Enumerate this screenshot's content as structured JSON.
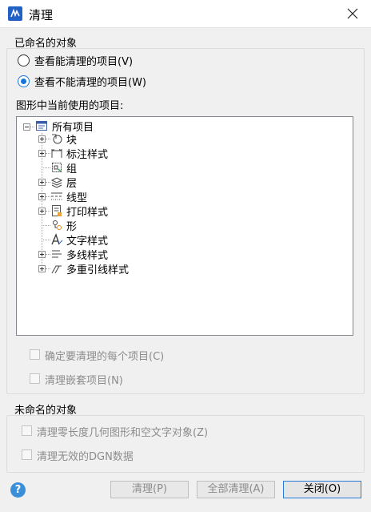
{
  "window": {
    "title": "清理",
    "icon": "app-logo-icon",
    "close_icon": "close-icon"
  },
  "named_objects": {
    "group_title": "已命名的对象",
    "radio_purgeable": "查看能清理的项目(V)",
    "radio_not_purgeable": "查看不能清理的项目(W)",
    "selected_radio": "radio_not_purgeable",
    "tree_label": "图形中当前使用的项目:",
    "tree": {
      "root": "所有项目",
      "items": [
        {
          "label": "块",
          "icon": "block-icon",
          "expandable": true
        },
        {
          "label": "标注样式",
          "icon": "dimension-style-icon",
          "expandable": true
        },
        {
          "label": "组",
          "icon": "group-icon",
          "expandable": false
        },
        {
          "label": "层",
          "icon": "layer-icon",
          "expandable": true
        },
        {
          "label": "线型",
          "icon": "linetype-icon",
          "expandable": true
        },
        {
          "label": "打印样式",
          "icon": "plot-style-icon",
          "expandable": true
        },
        {
          "label": "形",
          "icon": "shape-icon",
          "expandable": false
        },
        {
          "label": "文字样式",
          "icon": "text-style-icon",
          "expandable": false
        },
        {
          "label": "多线样式",
          "icon": "multiline-style-icon",
          "expandable": true
        },
        {
          "label": "多重引线样式",
          "icon": "multileader-style-icon",
          "expandable": true
        }
      ]
    },
    "confirm_each": "确定要清理的每个项目(C)",
    "purge_nested": "清理嵌套项目(N)"
  },
  "unnamed_objects": {
    "group_title": "未命名的对象",
    "purge_zero_length": "清理零长度几何图形和空文字对象(Z)",
    "purge_dgn": "清理无效的DGN数据"
  },
  "buttons": {
    "help": "?",
    "purge": "清理(P)",
    "purge_all": "全部清理(A)",
    "close": "关闭(O)"
  },
  "colors": {
    "accent": "#1a73d9",
    "disabled_text": "#8c8c8c"
  }
}
